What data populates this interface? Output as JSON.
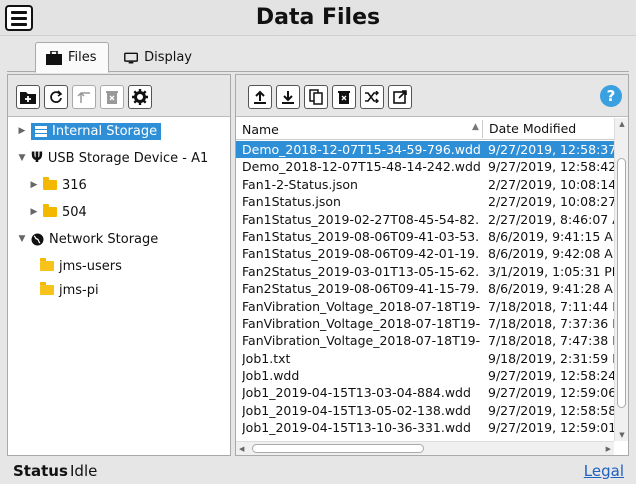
{
  "header": {
    "title": "Data Files"
  },
  "tabs": [
    {
      "label": "Files",
      "icon": "briefcase-icon",
      "active": true
    },
    {
      "label": "Display",
      "icon": "monitor-icon",
      "active": false
    }
  ],
  "left_toolbar": [
    "new-folder-icon",
    "refresh-icon",
    "up-icon",
    "delete-icon",
    "gear-icon"
  ],
  "right_toolbar": [
    "upload-icon",
    "download-icon",
    "copy-icon",
    "delete-icon",
    "shuffle-icon",
    "open-external-icon"
  ],
  "help_label": "?",
  "tree": {
    "internal": "Internal Storage",
    "usb": "USB Storage Device - A1",
    "folder1": "316",
    "folder2": "504",
    "network": "Network Storage",
    "net1": "jms-users",
    "net2": "jms-pi"
  },
  "table": {
    "col_name": "Name",
    "col_date": "Date Modified",
    "rows": [
      {
        "name": "Demo_2018-12-07T15-34-59-796.wdd",
        "date": "9/27/2019, 12:58:37"
      },
      {
        "name": "Demo_2018-12-07T15-48-14-242.wdd",
        "date": "9/27/2019, 12:58:42"
      },
      {
        "name": "Fan1-2-Status.json",
        "date": "2/27/2019, 10:08:14"
      },
      {
        "name": "Fan1Status.json",
        "date": "2/27/2019, 10:08:27"
      },
      {
        "name": "Fan1Status_2019-02-27T08-45-54-82...",
        "date": "2/27/2019, 8:46:07 A"
      },
      {
        "name": "Fan1Status_2019-08-06T09-41-03-53...",
        "date": "8/6/2019, 9:41:15 AM"
      },
      {
        "name": "Fan1Status_2019-08-06T09-42-01-19...",
        "date": "8/6/2019, 9:42:08 AM"
      },
      {
        "name": "Fan2Status_2019-03-01T13-05-15-62...",
        "date": "3/1/2019, 1:05:31 PM"
      },
      {
        "name": "Fan2Status_2019-08-06T09-41-15-79...",
        "date": "8/6/2019, 9:41:28 AM"
      },
      {
        "name": "FanVibration_Voltage_2018-07-18T19-...",
        "date": "7/18/2018, 7:11:44 P"
      },
      {
        "name": "FanVibration_Voltage_2018-07-18T19-...",
        "date": "7/18/2018, 7:37:36 P"
      },
      {
        "name": "FanVibration_Voltage_2018-07-18T19-...",
        "date": "7/18/2018, 7:47:38 P"
      },
      {
        "name": "Job1.txt",
        "date": "9/18/2019, 2:31:59 P"
      },
      {
        "name": "Job1.wdd",
        "date": "9/27/2019, 12:58:24"
      },
      {
        "name": "Job1_2019-04-15T13-03-04-884.wdd",
        "date": "9/27/2019, 12:59:06"
      },
      {
        "name": "Job1_2019-04-15T13-05-02-138.wdd",
        "date": "9/27/2019, 12:58:58"
      },
      {
        "name": "Job1_2019-04-15T13-10-36-331.wdd",
        "date": "9/27/2019, 12:59:01"
      }
    ]
  },
  "status": {
    "label": "Status",
    "value": "Idle",
    "legal": "Legal"
  },
  "colors": {
    "selection": "#2e8fd6",
    "folder": "#f5b800",
    "help": "#3aa0e0",
    "link": "#2060c0"
  }
}
